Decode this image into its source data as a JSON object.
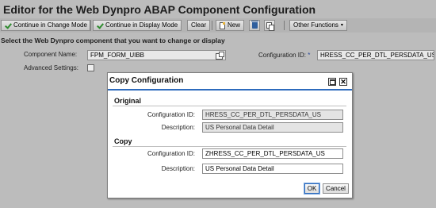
{
  "page": {
    "title": "Editor for the Web Dynpro ABAP Component Configuration"
  },
  "toolbar": {
    "continue_change": "Continue in Change Mode",
    "continue_display": "Continue in Display Mode",
    "clear": "Clear",
    "new": "New",
    "other_functions": "Other Functions"
  },
  "form": {
    "section_heading": "Select the Web Dynpro component that you want to change or display",
    "component_label": "Component Name:",
    "component_value": "FPM_FORM_UIBB",
    "config_label": "Configuration ID:",
    "required_marker": "*",
    "config_value": "HRESS_CC_PER_DTL_PERSDATA_US",
    "advanced_label": "Advanced Settings:"
  },
  "dialog": {
    "title": "Copy Configuration",
    "original": {
      "heading": "Original",
      "config_label": "Configuration ID:",
      "config_value": "HRESS_CC_PER_DTL_PERSDATA_US",
      "desc_label": "Description:",
      "desc_value": "US Personal Data Detail"
    },
    "copy": {
      "heading": "Copy",
      "config_label": "Configuration ID:",
      "config_value": "ZHRESS_CC_PER_DTL_PERSDATA_US",
      "desc_label": "Description:",
      "desc_value": "US Personal Data Detail"
    },
    "ok_label": "OK",
    "cancel_label": "Cancel"
  },
  "colors": {
    "accent": "#2d6bbd",
    "background": "#bcbcbc"
  }
}
